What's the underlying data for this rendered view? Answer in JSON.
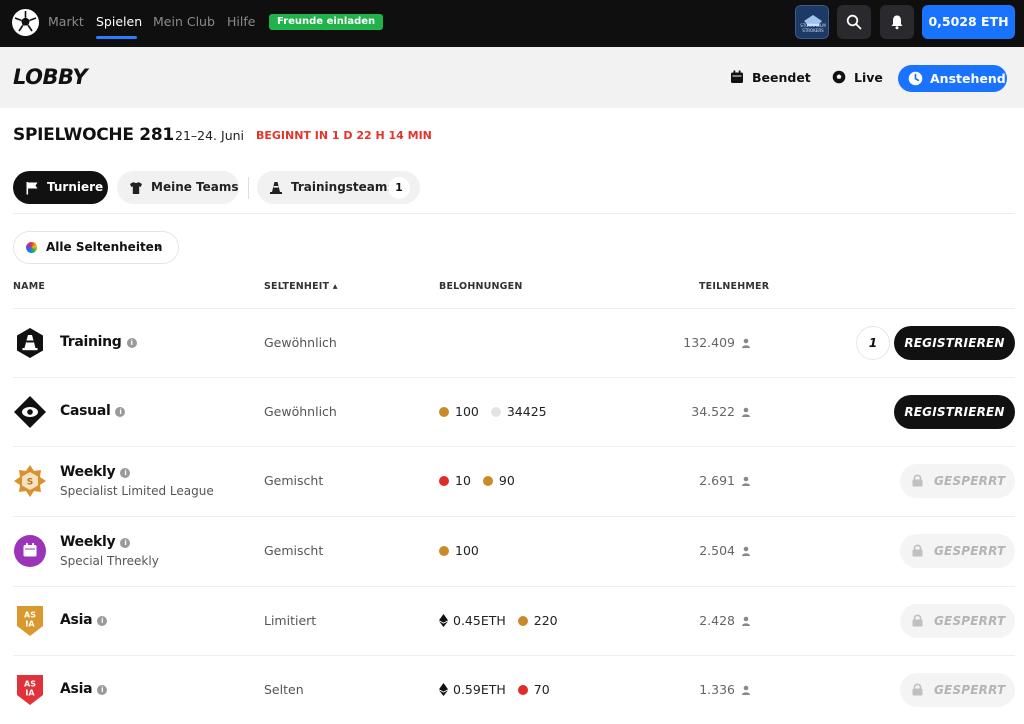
{
  "nav": {
    "items": [
      {
        "label": "Markt"
      },
      {
        "label": "Spielen"
      },
      {
        "label": "Mein Club"
      },
      {
        "label": "Hilfe"
      }
    ],
    "invite_label": "Freunde einladen",
    "club_badge_text": "STOCKHOLM STROKERS",
    "wallet_label": "0,5028 ETH",
    "colors": {
      "accent": "#1a73ff",
      "invite": "#1fb34a",
      "bar": "#0f0f10"
    }
  },
  "lobby": {
    "title": "LOBBY",
    "filters": [
      {
        "label": "Beendet",
        "icon": "calendar-icon"
      },
      {
        "label": "Live",
        "icon": "soccer-ball-icon"
      },
      {
        "label": "Anstehend",
        "icon": "clock-icon"
      }
    ]
  },
  "week": {
    "title": "SPIELWOCHE 281",
    "dates": "21–24. Juni",
    "starts_in": "BEGINNT IN 1 D 22 H 14 MIN"
  },
  "tabs": [
    {
      "label": "Turniere",
      "icon": "flag-icon"
    },
    {
      "label": "Meine Teams",
      "icon": "jersey-icon"
    },
    {
      "label": "Trainingsteams",
      "icon": "cone-icon",
      "count": "1"
    }
  ],
  "rarity_filter": {
    "label": "Alle Seltenheiten"
  },
  "table": {
    "headers": {
      "name": "NAME",
      "rarity": "SELTENHEIT ▴",
      "rewards": "BELOHNUNGEN",
      "participants": "TEILNEHMER"
    },
    "rows": [
      {
        "name": "Training",
        "sub": "",
        "rarity": "Gewöhnlich",
        "rewards": [],
        "participants": "132.409",
        "action": "REGISTRIEREN",
        "teams": "1"
      },
      {
        "name": "Casual",
        "sub": "",
        "rarity": "Gewöhnlich",
        "rewards": [
          {
            "value": "100",
            "coin": "#c98a2a"
          },
          {
            "value": "34425",
            "coin": "#e4e4e4"
          }
        ],
        "participants": "34.522",
        "action": "REGISTRIEREN"
      },
      {
        "name": "Weekly",
        "sub": "Specialist Limited League",
        "rarity": "Gemischt",
        "rewards": [
          {
            "value": "10",
            "coin": "#e02b2b"
          },
          {
            "value": "90",
            "coin": "#c98a2a"
          }
        ],
        "participants": "2.691",
        "action": "GESPERRT"
      },
      {
        "name": "Weekly",
        "sub": "Special Threekly",
        "rarity": "Gemischt",
        "rewards": [
          {
            "value": "100",
            "coin": "#c98a2a"
          }
        ],
        "participants": "2.504",
        "action": "GESPERRT"
      },
      {
        "name": "Asia",
        "sub": "",
        "rarity": "Limitiert",
        "rewards": [
          {
            "value": "0.45ETH",
            "coin": "eth"
          },
          {
            "value": "220",
            "coin": "#c98a2a"
          }
        ],
        "participants": "2.428",
        "action": "GESPERRT"
      },
      {
        "name": "Asia",
        "sub": "",
        "rarity": "Selten",
        "rewards": [
          {
            "value": "0.59ETH",
            "coin": "eth"
          },
          {
            "value": "70",
            "coin": "#e02b2b"
          }
        ],
        "participants": "1.336",
        "action": "GESPERRT"
      }
    ]
  }
}
